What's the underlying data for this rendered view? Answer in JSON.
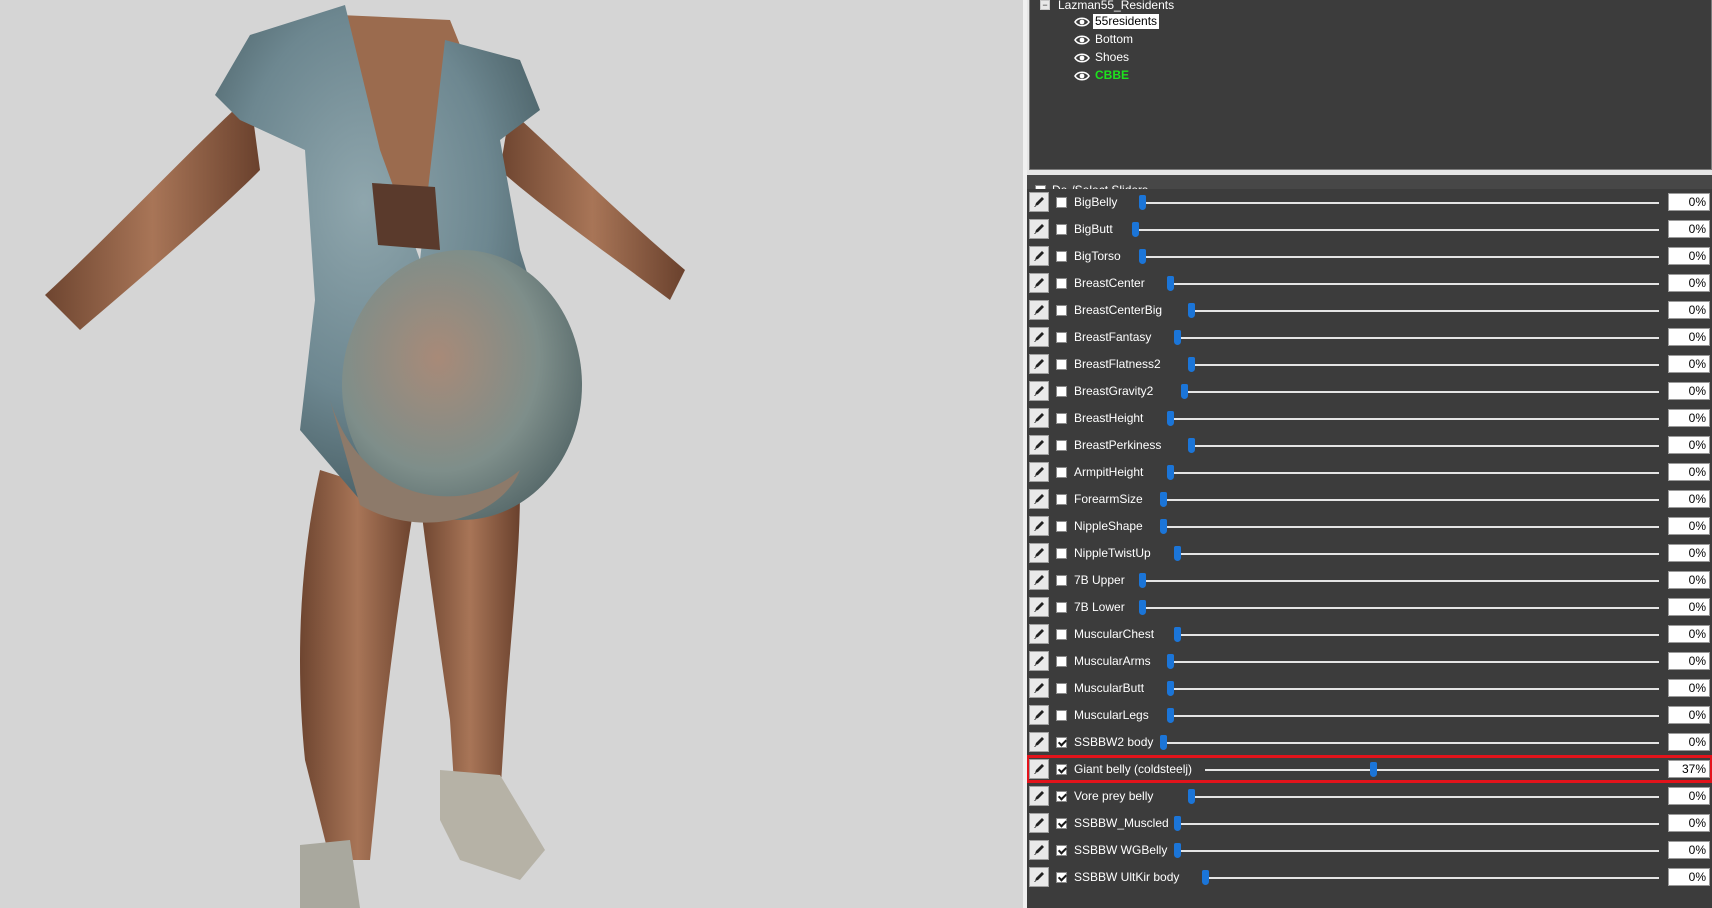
{
  "tree": {
    "root_label": "Lazman55_Residents",
    "items": [
      {
        "label": "55residents",
        "selected": true,
        "highlight": false
      },
      {
        "label": "Bottom",
        "selected": false,
        "highlight": false
      },
      {
        "label": "Shoes",
        "selected": false,
        "highlight": false
      },
      {
        "label": "CBBE",
        "selected": false,
        "highlight": true
      }
    ]
  },
  "sliders_header": {
    "label": "De-/Select Sliders",
    "checked": false
  },
  "sliders": [
    {
      "name": "BigBelly",
      "checked": false,
      "value": "0%",
      "level": 0.0
    },
    {
      "name": "BigButt",
      "checked": false,
      "value": "0%",
      "level": 0.0
    },
    {
      "name": "BigTorso",
      "checked": false,
      "value": "0%",
      "level": 0.0
    },
    {
      "name": "BreastCenter",
      "checked": false,
      "value": "0%",
      "level": 0.0
    },
    {
      "name": "BreastCenterBig",
      "checked": false,
      "value": "0%",
      "level": 0.0
    },
    {
      "name": "BreastFantasy",
      "checked": false,
      "value": "0%",
      "level": 0.0
    },
    {
      "name": "BreastFlatness2",
      "checked": false,
      "value": "0%",
      "level": 0.0
    },
    {
      "name": "BreastGravity2",
      "checked": false,
      "value": "0%",
      "level": 0.0
    },
    {
      "name": "BreastHeight",
      "checked": false,
      "value": "0%",
      "level": 0.0
    },
    {
      "name": "BreastPerkiness",
      "checked": false,
      "value": "0%",
      "level": 0.0
    },
    {
      "name": "ArmpitHeight",
      "checked": false,
      "value": "0%",
      "level": 0.0
    },
    {
      "name": "ForearmSize",
      "checked": false,
      "value": "0%",
      "level": 0.0
    },
    {
      "name": "NippleShape",
      "checked": false,
      "value": "0%",
      "level": 0.0
    },
    {
      "name": "NippleTwistUp",
      "checked": false,
      "value": "0%",
      "level": 0.0
    },
    {
      "name": "7B Upper",
      "checked": false,
      "value": "0%",
      "level": 0.0
    },
    {
      "name": "7B Lower",
      "checked": false,
      "value": "0%",
      "level": 0.0
    },
    {
      "name": "MuscularChest",
      "checked": false,
      "value": "0%",
      "level": 0.0
    },
    {
      "name": "MuscularArms",
      "checked": false,
      "value": "0%",
      "level": 0.0
    },
    {
      "name": "MuscularButt",
      "checked": false,
      "value": "0%",
      "level": 0.0
    },
    {
      "name": "MuscularLegs",
      "checked": false,
      "value": "0%",
      "level": 0.0
    },
    {
      "name": "SSBBW2 body",
      "checked": true,
      "value": "0%",
      "level": 0.0
    },
    {
      "name": "Giant belly (coldsteelj)",
      "checked": true,
      "value": "37%",
      "level": 0.37,
      "highlighted": true
    },
    {
      "name": "Vore prey belly",
      "checked": true,
      "value": "0%",
      "level": 0.0
    },
    {
      "name": "SSBBW_Muscled",
      "checked": true,
      "value": "0%",
      "level": 0.0
    },
    {
      "name": "SSBBW WGBelly",
      "checked": true,
      "value": "0%",
      "level": 0.0
    },
    {
      "name": "SSBBW UltKir body",
      "checked": true,
      "value": "0%",
      "level": 0.0
    }
  ],
  "colors": {
    "panel_bg": "#3c3c3c",
    "thumb": "#1b75d8",
    "highlight_border": "#e3131b",
    "cbbe_text": "#1de21d"
  }
}
